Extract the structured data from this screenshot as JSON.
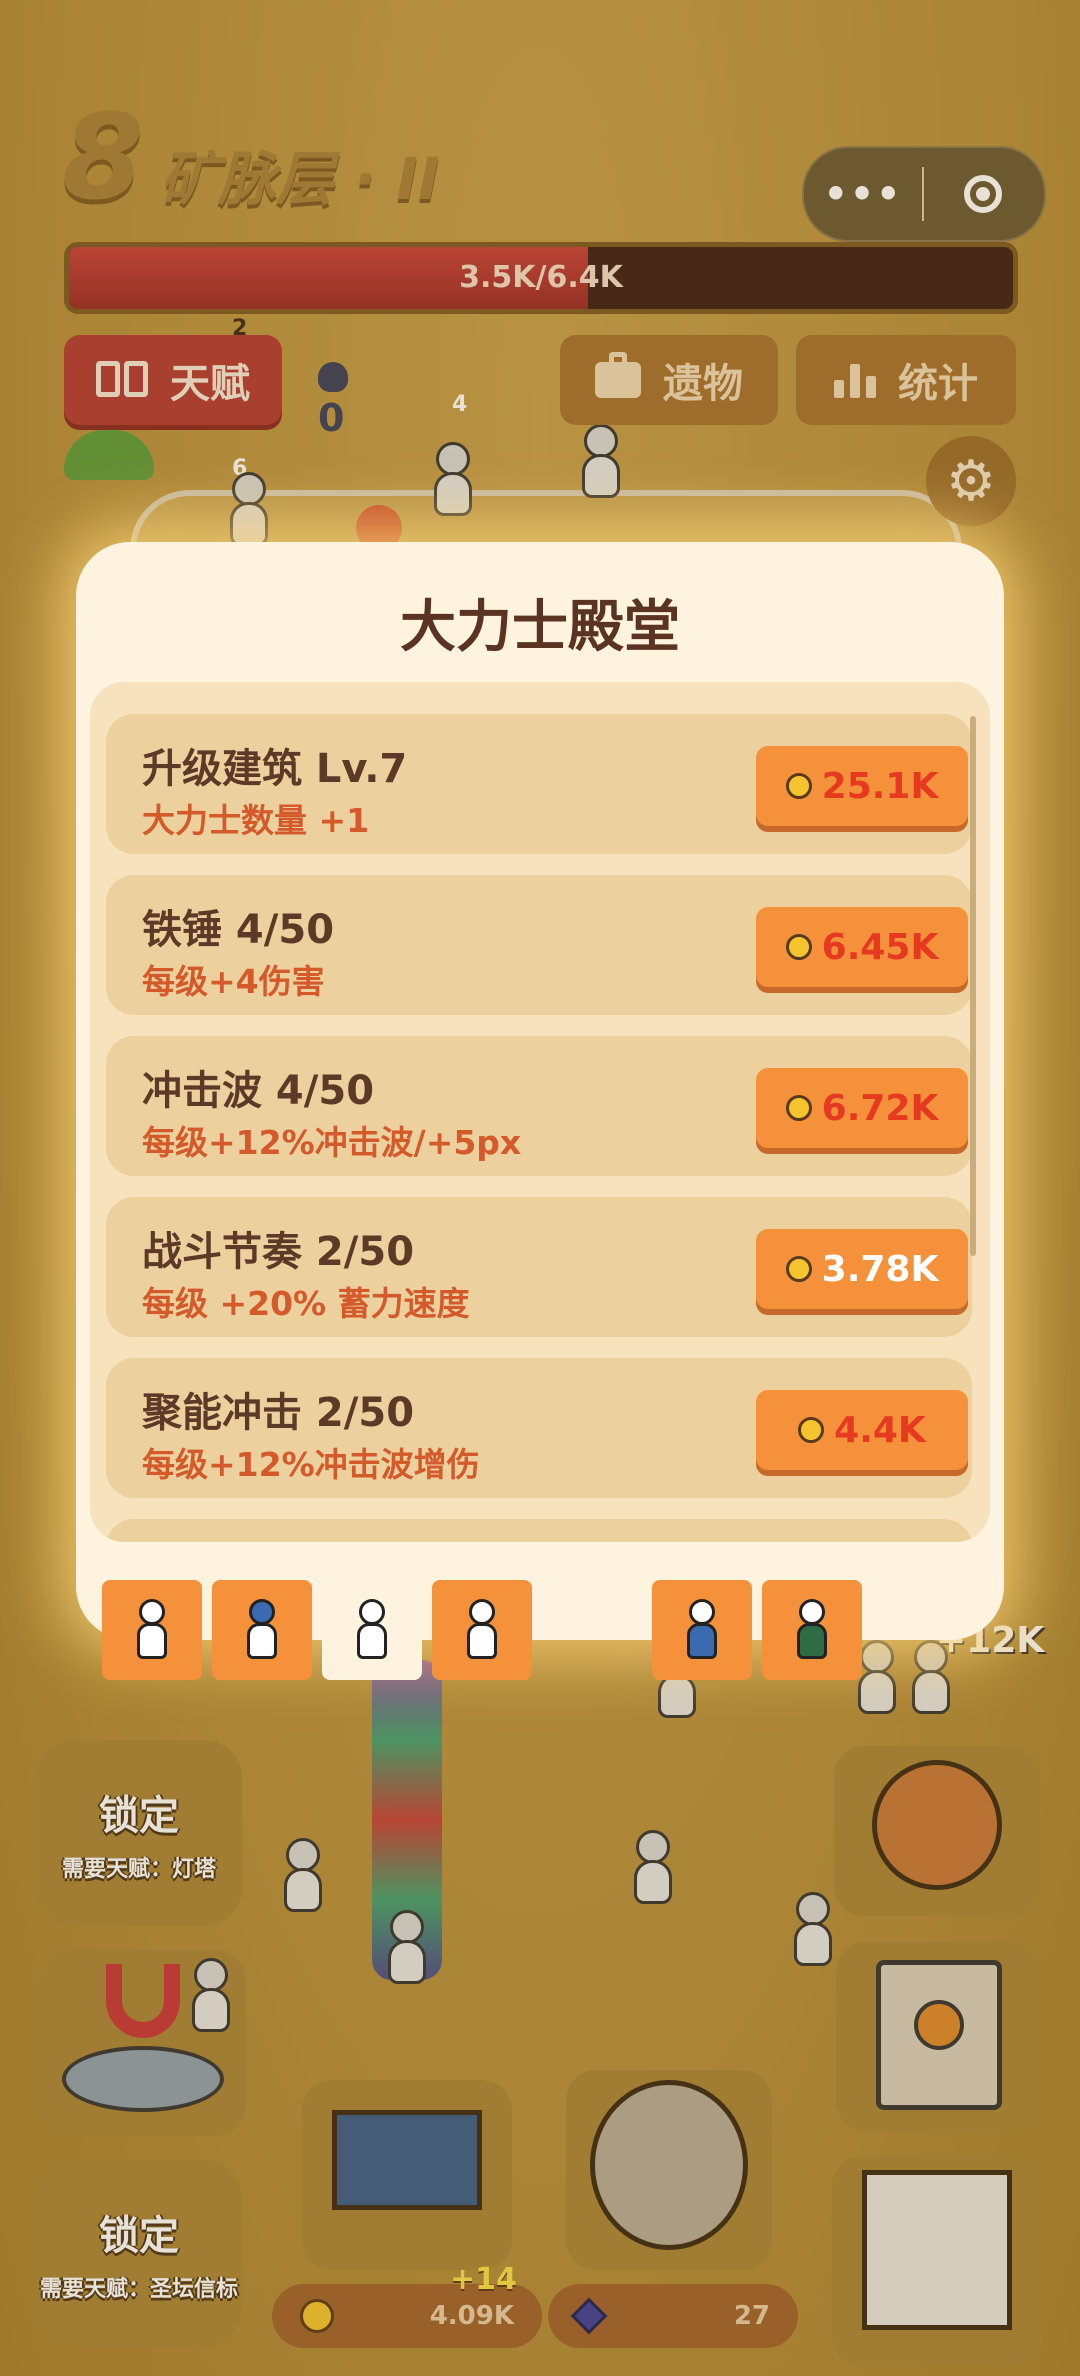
{
  "header": {
    "level_number": "8",
    "level_name": "矿脉层 · II",
    "hp_text": "3.5K/6.4K",
    "hp_fraction": 0.55,
    "capsule_more": "•••",
    "gem_count": "0"
  },
  "tabs": {
    "talent": "天赋",
    "relic": "遗物",
    "stats": "统计"
  },
  "modal": {
    "title": "大力士殿堂",
    "upgrades": [
      {
        "name": "升级建筑 Lv.7",
        "desc": "大力士数量 +1",
        "cost": "25.1K",
        "affordable": false
      },
      {
        "name": "铁锤 4/50",
        "desc": "每级+4伤害",
        "cost": "6.45K",
        "affordable": false
      },
      {
        "name": "冲击波 4/50",
        "desc": "每级+12%冲击波/+5px",
        "cost": "6.72K",
        "affordable": false
      },
      {
        "name": "战斗节奏 2/50",
        "desc": "每级 +20% 蓄力速度",
        "cost": "3.78K",
        "affordable": true
      },
      {
        "name": "聚能冲击 2/50",
        "desc": "每级+12%冲击波增伤",
        "cost": "4.4K",
        "affordable": false
      }
    ]
  },
  "scene": {
    "worker_labels": [
      "2",
      "6",
      "4"
    ],
    "lock_1_title": "锁定",
    "lock_1_req": "需要天赋：灯塔",
    "lock_2_title": "锁定",
    "lock_2_req": "需要天赋：圣坛信标",
    "floating_plus_coins": "+14",
    "floating_plus_k": "+12K"
  },
  "resources": {
    "coins": "4.09K",
    "gems": "27"
  },
  "colors": {
    "accent_orange": "#f5913a",
    "unaffordable_red": "#e63a20",
    "talent_red": "#b43a33",
    "panel_cream": "#fdf3df"
  }
}
